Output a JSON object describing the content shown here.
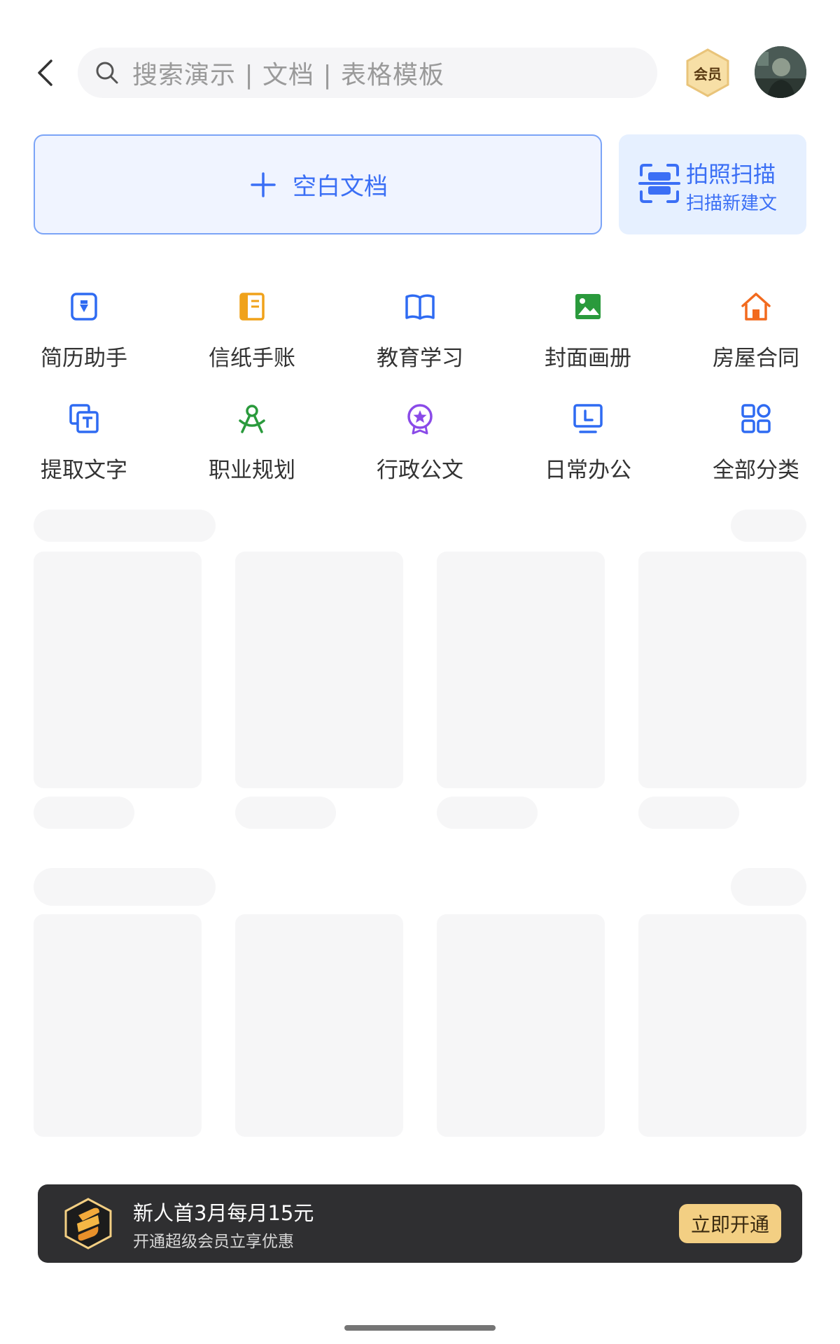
{
  "header": {
    "search_placeholder": "搜索演示 | 文档 | 表格模板",
    "vip_label": "会员",
    "icons": {
      "back": "chevron-left-icon",
      "search": "search-icon"
    }
  },
  "create": {
    "blank_label": "空白文档",
    "scan_title": "拍照扫描",
    "scan_subtitle": "扫描新建文"
  },
  "categories": [
    {
      "label": "简历助手",
      "icon": "resume-icon",
      "color": "#2f6bf2"
    },
    {
      "label": "信纸手账",
      "icon": "notebook-icon",
      "color": "#f0a21a"
    },
    {
      "label": "教育学习",
      "icon": "book-icon",
      "color": "#2f6bf2"
    },
    {
      "label": "封面画册",
      "icon": "image-icon",
      "color": "#2a9a3c"
    },
    {
      "label": "房屋合同",
      "icon": "house-icon",
      "color": "#f26a1e"
    },
    {
      "label": "提取文字",
      "icon": "text-extract-icon",
      "color": "#2f6bf2"
    },
    {
      "label": "职业规划",
      "icon": "compass-icon",
      "color": "#2a9a3c"
    },
    {
      "label": "行政公文",
      "icon": "badge-icon",
      "color": "#8a4ae8"
    },
    {
      "label": "日常办公",
      "icon": "monitor-icon",
      "color": "#2f6bf2"
    },
    {
      "label": "全部分类",
      "icon": "grid-icon",
      "color": "#2f6bf2"
    }
  ],
  "promo": {
    "title": "新人首3月每月15元",
    "subtitle": "开通超级会员立享优惠",
    "button": "立即开通"
  }
}
